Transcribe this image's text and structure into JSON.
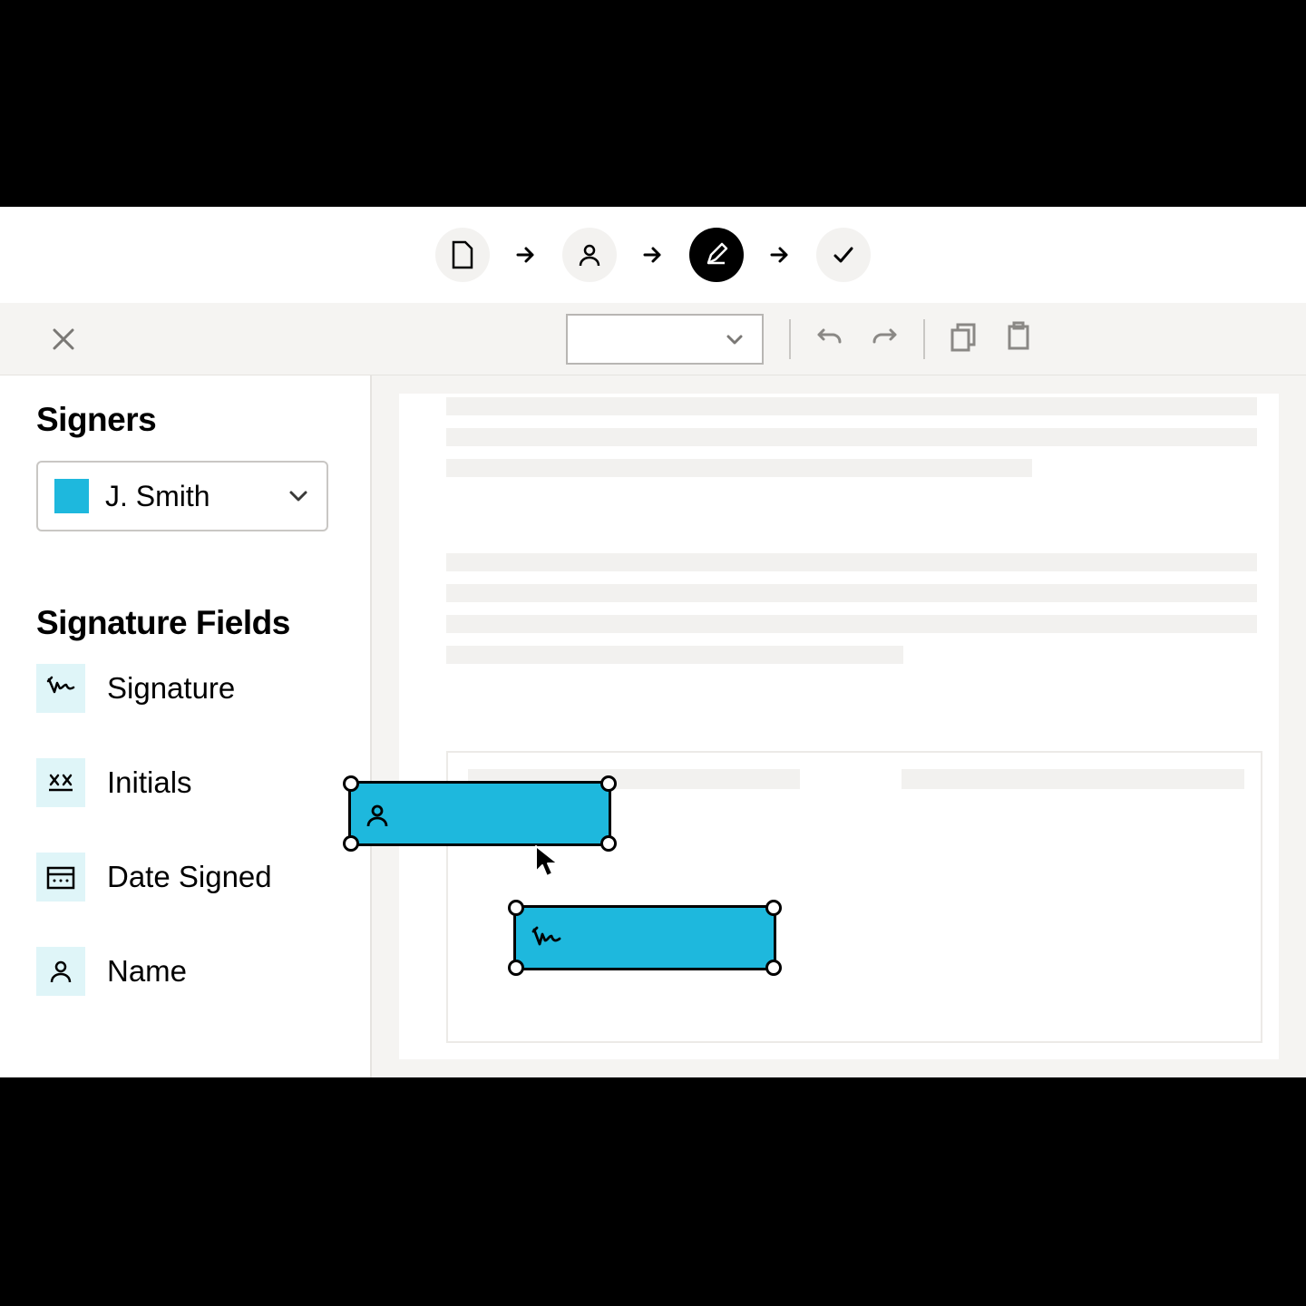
{
  "stepper": {
    "steps": [
      "document",
      "recipient",
      "prepare",
      "review"
    ],
    "active_index": 2
  },
  "toolbar": {
    "zoom_value": ""
  },
  "sidebar": {
    "signers_heading": "Signers",
    "selected_signer": "J. Smith",
    "signer_color": "#1eb8dd",
    "fields_heading": "Signature Fields",
    "fields": [
      {
        "id": "signature",
        "label": "Signature"
      },
      {
        "id": "initials",
        "label": "Initials"
      },
      {
        "id": "date-signed",
        "label": "Date Signed"
      },
      {
        "id": "name",
        "label": "Name"
      }
    ]
  },
  "canvas": {
    "dragged_field_type": "name",
    "placed_field_type": "signature"
  }
}
